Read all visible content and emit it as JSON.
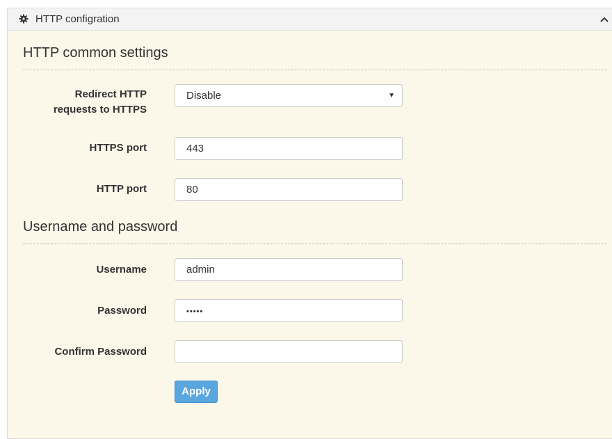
{
  "panel": {
    "header_title": "HTTP configration",
    "header_icon": "gear-icon",
    "collapse_icon": "chevron-up-icon"
  },
  "http_common": {
    "title": "HTTP common settings",
    "redirect": {
      "label": "Redirect HTTP requests to HTTPS",
      "value": "Disable"
    },
    "https_port": {
      "label": "HTTPS port",
      "value": "443"
    },
    "http_port": {
      "label": "HTTP port",
      "value": "80"
    }
  },
  "credentials": {
    "title": "Username and password",
    "username": {
      "label": "Username",
      "value": "admin"
    },
    "password": {
      "label": "Password",
      "value": "•••••"
    },
    "confirm_password": {
      "label": "Confirm Password",
      "value": ""
    }
  },
  "apply_label": "Apply"
}
